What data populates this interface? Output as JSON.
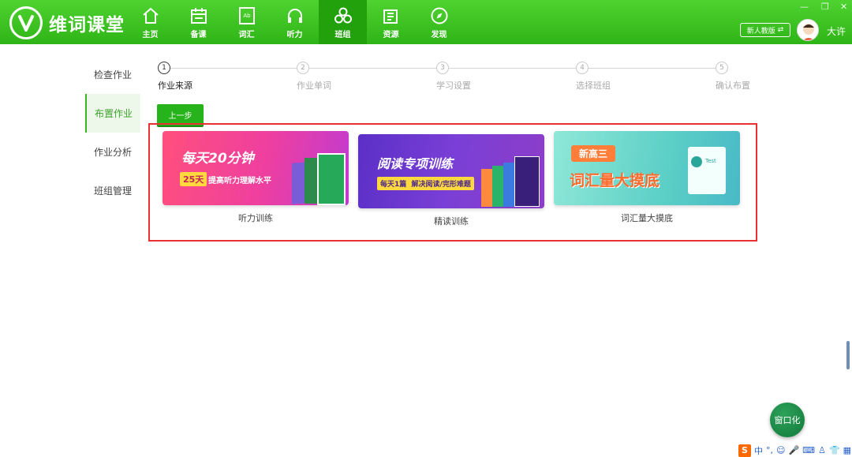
{
  "app": {
    "name": "维词课堂"
  },
  "nav": [
    {
      "label": "主页",
      "icon": "home-icon"
    },
    {
      "label": "备课",
      "icon": "calendar-icon"
    },
    {
      "label": "词汇",
      "icon": "vocab-book-icon"
    },
    {
      "label": "听力",
      "icon": "headphones-icon"
    },
    {
      "label": "班组",
      "icon": "group-icon",
      "active": true
    },
    {
      "label": "资源",
      "icon": "resource-icon"
    },
    {
      "label": "发现",
      "icon": "compass-icon"
    }
  ],
  "header": {
    "new_edition_label": "新人教版",
    "user_name": "大许"
  },
  "sidemenu": [
    {
      "label": "检查作业"
    },
    {
      "label": "布置作业",
      "active": true
    },
    {
      "label": "作业分析"
    },
    {
      "label": "班组管理"
    }
  ],
  "steps": [
    {
      "num": "1",
      "label": "作业来源",
      "current": true
    },
    {
      "num": "2",
      "label": "作业单词"
    },
    {
      "num": "3",
      "label": "学习设置"
    },
    {
      "num": "4",
      "label": "选择班组"
    },
    {
      "num": "5",
      "label": "确认布置"
    }
  ],
  "prev_button": "上一步",
  "cards": [
    {
      "label": "听力训练",
      "banner_title": "每天20分钟",
      "banner_badge": "25天",
      "banner_sub": "提高听力理解水平"
    },
    {
      "label": "精读训练",
      "banner_title": "阅读专项训练",
      "banner_sub": "每天1篇  解决阅读/完形难题"
    },
    {
      "label": "词汇量大摸底",
      "banner_tag": "新高三",
      "banner_title": "词汇量大摸底",
      "banner_test": "Test"
    }
  ],
  "fab_label": "窗口化",
  "tray": {
    "ime": "中"
  },
  "colors": {
    "brand_green": "#3cc323",
    "active_nav": "#23a10d",
    "highlight_border": "#e8312e"
  }
}
